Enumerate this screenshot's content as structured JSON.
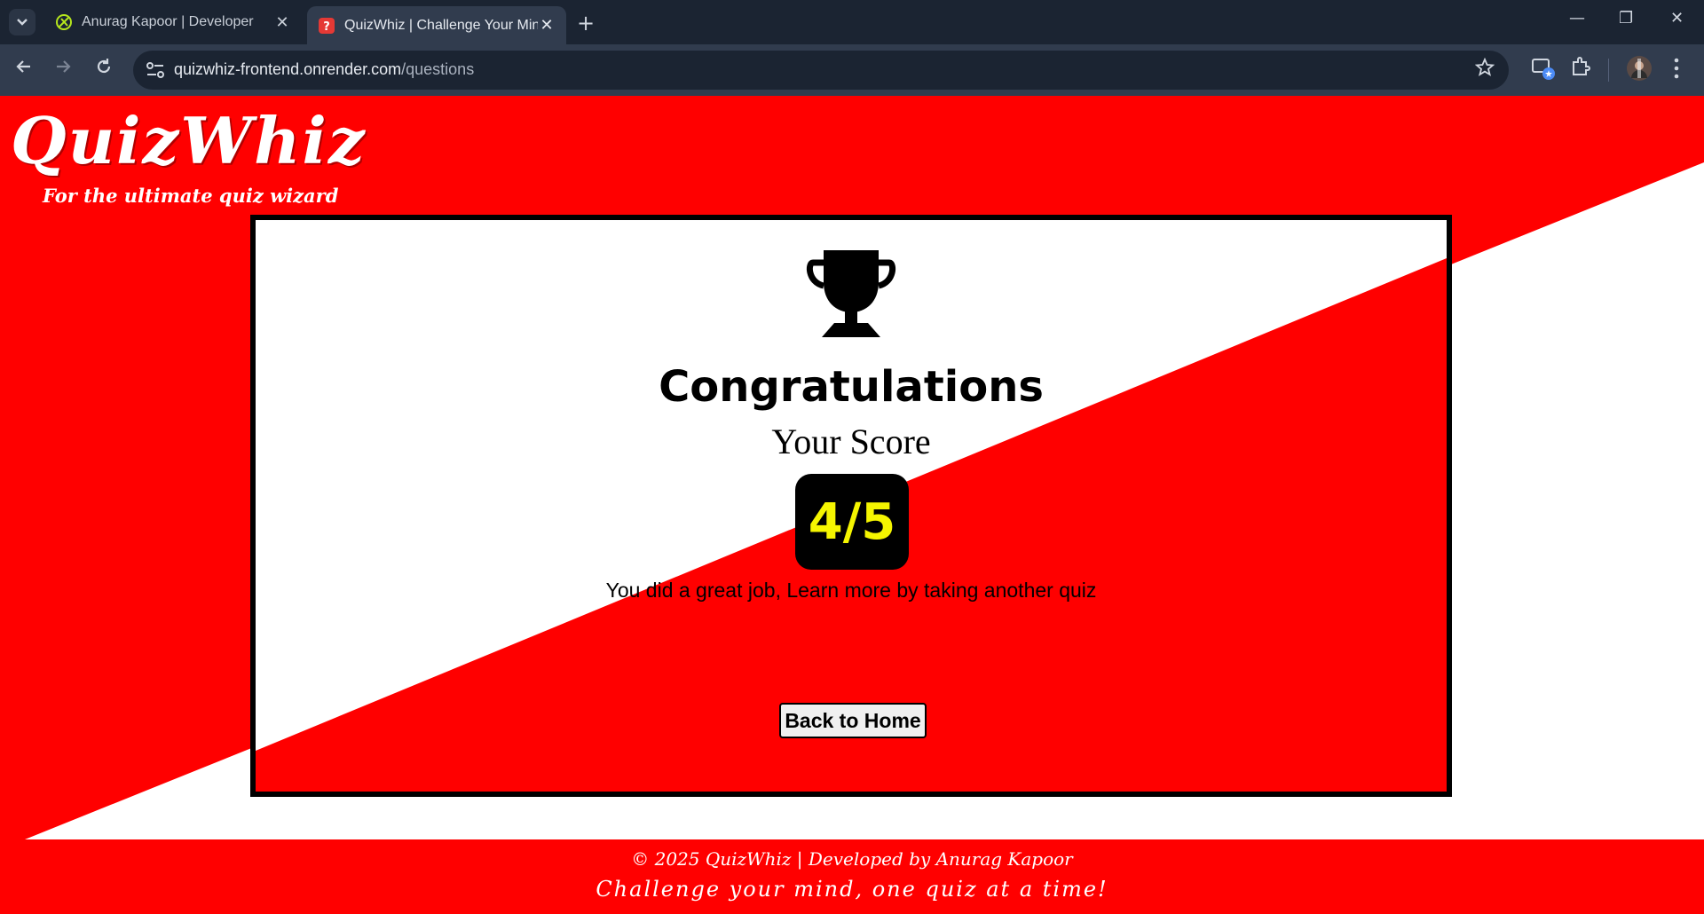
{
  "browser": {
    "tabs": [
      {
        "title": "Anurag Kapoor | Developer",
        "active": false
      },
      {
        "title": "QuizWhiz | Challenge Your Mind",
        "active": true
      }
    ],
    "new_tab_symbol": "+",
    "close_symbol": "✕",
    "url_host": "quizwhiz-frontend.onrender.com",
    "url_path": "/questions",
    "window_controls": {
      "minimize": "—",
      "restore": "❐",
      "close": "✕"
    },
    "icons": [
      "tab-list-icon",
      "back-arrow-icon",
      "forward-arrow-icon",
      "reload-icon",
      "site-settings-icon",
      "bookmark-star-icon",
      "cast-icon",
      "extensions-icon",
      "profile-avatar-icon",
      "menu-dots-icon"
    ]
  },
  "header": {
    "brand": "QuizWhiz",
    "tagline": "For the ultimate quiz wizard"
  },
  "result": {
    "heading": "Congratulations",
    "score_label": "Your Score",
    "score": "4/5",
    "score_value": 4,
    "score_total": 5,
    "message": "You did a great job, Learn more by taking another quiz",
    "button_label": "Back to Home",
    "icon": "trophy-icon"
  },
  "footer": {
    "copyright": "© 2025 QuizWhiz | Developed by Anurag Kapoor",
    "slogan": "Challenge your mind, one quiz at a time!"
  },
  "colors": {
    "primary_red": "#ff0000",
    "score_text": "#f5f500",
    "score_bg": "#000000",
    "chrome_dark": "#1b2432",
    "chrome_toolbar": "#313c4e"
  }
}
